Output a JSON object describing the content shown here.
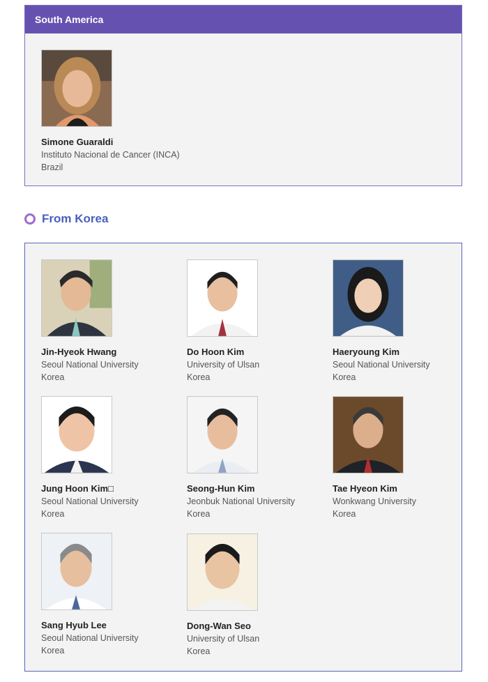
{
  "south_america": {
    "title": "South America",
    "people": [
      {
        "name": "Simone Guaraldi",
        "affiliation": "Instituto Nacional de Cancer (INCA)",
        "country": "Brazil"
      }
    ]
  },
  "korea": {
    "title": "From Korea",
    "people": [
      {
        "name": "Jin-Hyeok Hwang",
        "affiliation": "Seoul National University",
        "country": "Korea"
      },
      {
        "name": "Do Hoon Kim",
        "affiliation": "University of Ulsan",
        "country": "Korea"
      },
      {
        "name": "Haeryoung Kim",
        "affiliation": "Seoul National University",
        "country": "Korea"
      },
      {
        "name": "Jung Hoon Kim□",
        "affiliation": "Seoul National University",
        "country": "Korea"
      },
      {
        "name": "Seong-Hun Kim",
        "affiliation": "Jeonbuk National University",
        "country": "Korea"
      },
      {
        "name": "Tae Hyeon Kim",
        "affiliation": "Wonkwang University",
        "country": "Korea"
      },
      {
        "name": "Sang Hyub Lee",
        "affiliation": "Seoul National University",
        "country": "Korea"
      },
      {
        "name": "Dong-Wan Seo",
        "affiliation": "University of Ulsan",
        "country": "Korea"
      }
    ]
  }
}
